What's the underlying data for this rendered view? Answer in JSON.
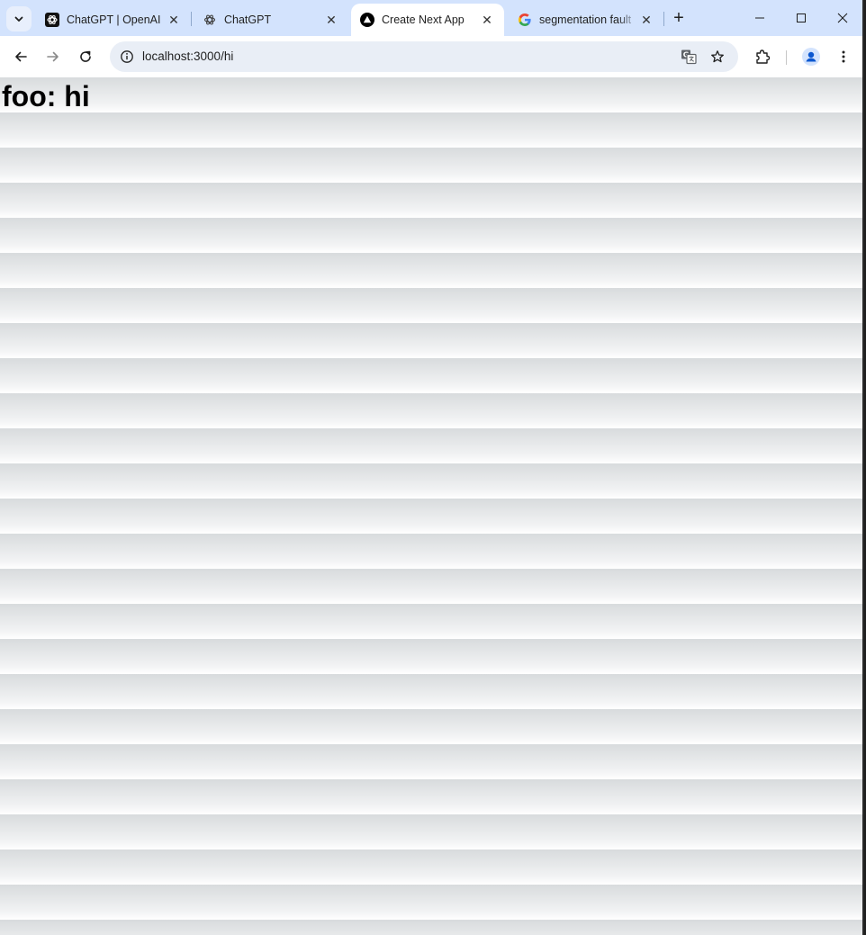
{
  "browser": {
    "tabs": [
      {
        "title": "ChatGPT | OpenAI",
        "icon": "openai-black-icon",
        "active": false
      },
      {
        "title": "ChatGPT",
        "icon": "openai-icon",
        "active": false
      },
      {
        "title": "Create Next App",
        "icon": "vercel-triangle-icon",
        "active": true
      },
      {
        "title": "segmentation fault",
        "icon": "google-g-icon",
        "active": false
      }
    ],
    "close_glyph": "✕",
    "new_tab_glyph": "+",
    "address_bar": {
      "url": "localhost:3000/hi"
    },
    "colors": {
      "tabstrip": "#d3e3fd",
      "omnibox": "#e9eef6",
      "profile": "#0b57d0"
    }
  },
  "page": {
    "heading": "foo: hi"
  }
}
